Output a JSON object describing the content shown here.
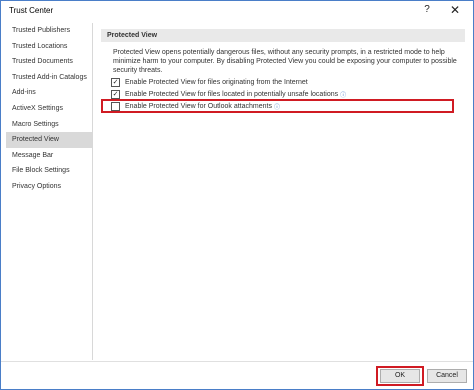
{
  "window": {
    "title": "Trust Center",
    "help_glyph": "?",
    "close_glyph": "✕"
  },
  "sidebar": {
    "items": [
      {
        "label": "Trusted Publishers"
      },
      {
        "label": "Trusted Locations"
      },
      {
        "label": "Trusted Documents"
      },
      {
        "label": "Trusted Add-in Catalogs"
      },
      {
        "label": "Add-ins"
      },
      {
        "label": "ActiveX Settings"
      },
      {
        "label": "Macro Settings"
      },
      {
        "label": "Protected View"
      },
      {
        "label": "Message Bar"
      },
      {
        "label": "File Block Settings"
      },
      {
        "label": "Privacy Options"
      }
    ],
    "selected": "Protected View"
  },
  "main": {
    "section_title": "Protected View",
    "description": "Protected View opens potentially dangerous files, without any security prompts, in a restricted mode to help minimize harm to your computer. By disabling Protected View you could be exposing your computer to possible security threats.",
    "options": [
      {
        "label": "Enable Protected View for files originating from the Internet",
        "checked": true
      },
      {
        "label": "Enable Protected View for files located in potentially unsafe locations",
        "checked": true
      },
      {
        "label": "Enable Protected View for Outlook attachments",
        "checked": false
      }
    ],
    "checkmark": "✓",
    "info_glyph": "ⓘ"
  },
  "footer": {
    "ok_label": "OK",
    "cancel_label": "Cancel"
  },
  "colors": {
    "highlight": "#d01b23",
    "selected_bg": "#d9d9d9",
    "info": "#3b73c8"
  }
}
